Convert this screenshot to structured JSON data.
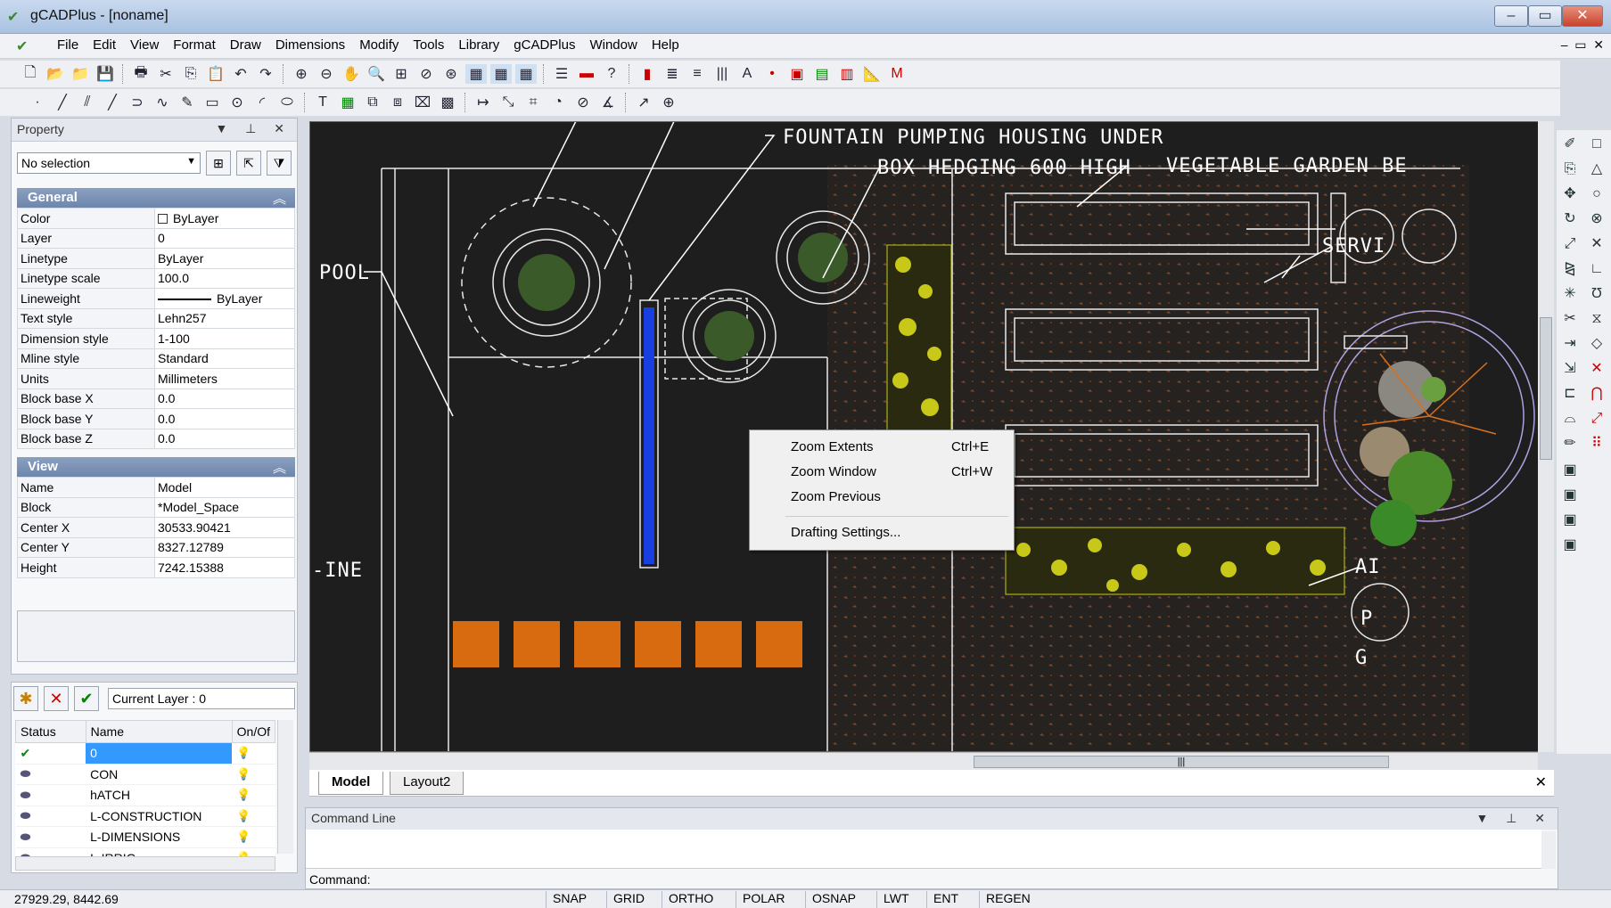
{
  "window": {
    "title": "gCADPlus - [noname]",
    "controls": [
      "–",
      "▭",
      "✕"
    ]
  },
  "menu": [
    "File",
    "Edit",
    "View",
    "Format",
    "Draw",
    "Dimensions",
    "Modify",
    "Tools",
    "Library",
    "gCADPlus",
    "Window",
    "Help"
  ],
  "property_panel": {
    "title": "Property",
    "selection": "No selection",
    "general": {
      "heading": "General",
      "rows": [
        {
          "k": "Color",
          "v": "ByLayer"
        },
        {
          "k": "Layer",
          "v": "0"
        },
        {
          "k": "Linetype",
          "v": "ByLayer"
        },
        {
          "k": "Linetype scale",
          "v": "100.0"
        },
        {
          "k": "Lineweight",
          "v": "ByLayer"
        },
        {
          "k": "Text style",
          "v": "Lehn257"
        },
        {
          "k": "Dimension style",
          "v": "1-100"
        },
        {
          "k": "Mline style",
          "v": "Standard"
        },
        {
          "k": "Units",
          "v": "Millimeters"
        },
        {
          "k": "Block base X",
          "v": "0.0"
        },
        {
          "k": "Block base Y",
          "v": "0.0"
        },
        {
          "k": "Block base Z",
          "v": "0.0"
        }
      ]
    },
    "view": {
      "heading": "View",
      "rows": [
        {
          "k": "Name",
          "v": "Model"
        },
        {
          "k": "Block",
          "v": "*Model_Space"
        },
        {
          "k": "Center X",
          "v": "30533.90421"
        },
        {
          "k": "Center Y",
          "v": "8327.12789"
        },
        {
          "k": "Height",
          "v": "7242.15388"
        }
      ]
    }
  },
  "layers": {
    "current": "Current Layer : 0",
    "headers": [
      "Status",
      "Name",
      "On/Of"
    ],
    "rows": [
      {
        "name": "0"
      },
      {
        "name": "CON"
      },
      {
        "name": "hATCH"
      },
      {
        "name": "L-CONSTRUCTION"
      },
      {
        "name": "L-DIMENSIONS"
      },
      {
        "name": "L-IRRIG"
      }
    ]
  },
  "drawing": {
    "labels": [
      "FOUNTAIN PUMPING HOUSING UNDER",
      "BOX HEDGING 600 HIGH",
      "VEGETABLE GARDEN BE",
      "POOL",
      "SERVI",
      "-INE",
      "AI",
      "P",
      "G"
    ]
  },
  "context_menu": {
    "items": [
      {
        "label": "Zoom Extents",
        "shortcut": "Ctrl+E"
      },
      {
        "label": "Zoom Window",
        "shortcut": "Ctrl+W"
      },
      {
        "label": "Zoom Previous",
        "shortcut": ""
      },
      {
        "label": "Drafting Settings...",
        "shortcut": ""
      }
    ]
  },
  "tabs": [
    "Model",
    "Layout2"
  ],
  "command": {
    "title": "Command Line",
    "prompt": "Command:"
  },
  "status": {
    "coords": "27929.29, 8442.69",
    "buttons": [
      "SNAP",
      "GRID",
      "ORTHO",
      "POLAR",
      "OSNAP",
      "LWT",
      "ENT",
      "REGEN"
    ]
  },
  "colors": {
    "canvas": "#1e1e1e",
    "accent": "#3399ff",
    "pool": "#1a3fe0",
    "pavers": "#d86a10",
    "hedge": "#c8c818"
  }
}
